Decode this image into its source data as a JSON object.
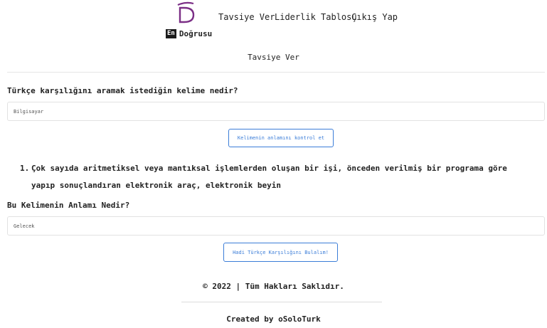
{
  "header": {
    "nav": [
      {
        "label": "Tavsiye Ver",
        "active": true
      },
      {
        "label": "Liderlik Tablosu",
        "active": false
      },
      {
        "label": "Çıkış Yap",
        "active": false
      }
    ],
    "brand_badge": "En",
    "brand_text": "Doğrusu",
    "logo_letter": "D"
  },
  "page_title": "Tavsiye Ver",
  "search": {
    "question": "Türkçe karşılığını aramak istediğin kelime nedir?",
    "value": "Bilgisayar",
    "check_button": "Kelimenin anlamını kontrol et"
  },
  "meanings": [
    {
      "number": "1.",
      "text": "Çok sayıda aritmetiksel veya mantıksal işlemlerden oluşan bir işi, önceden verilmiş bir programa göre yapıp sonuçlandıran elektronik araç, elektronik beyin"
    }
  ],
  "answer": {
    "question": "Bu Kelimenin Anlamı Nedir?",
    "value": "Gelecek",
    "submit_button": "Hadi Türkçe Karşılığını Bulalım!"
  },
  "footer": {
    "copyright": "© 2022 | Tüm Hakları Saklıdır.",
    "credit": "Created by oSoloTurk"
  },
  "colors": {
    "accent": "#3b7dd8",
    "logo": "#7b2f86"
  }
}
